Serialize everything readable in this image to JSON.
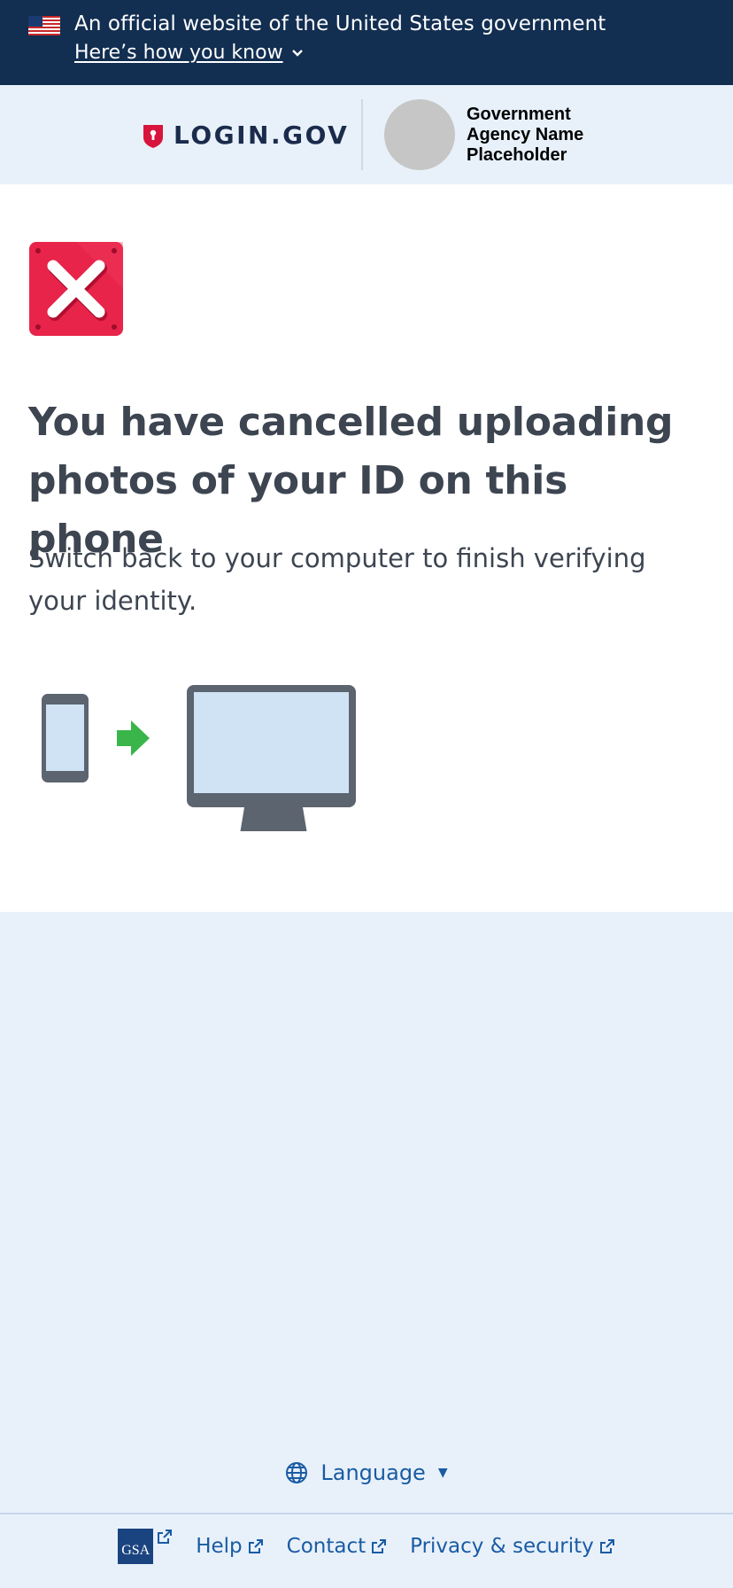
{
  "gov_banner": {
    "text": "An official website of the United States government",
    "link": "Here’s how you know"
  },
  "header": {
    "logo_text": "LOGIN.GOV",
    "agency_name": "Government Agency Name Placeholder"
  },
  "main": {
    "heading": "You have cancelled uploading photos of your ID on this phone",
    "lead": "Switch back to your computer to finish verifying your identity."
  },
  "footer": {
    "language": "Language",
    "gsa": "GSA",
    "links": [
      "Help",
      "Contact",
      "Privacy & security"
    ]
  },
  "colors": {
    "banner_bg": "#122e51",
    "page_bg": "#e8f1fa",
    "link": "#1a5ba4",
    "error": "#d8143c",
    "arrow": "#3ab54a"
  }
}
